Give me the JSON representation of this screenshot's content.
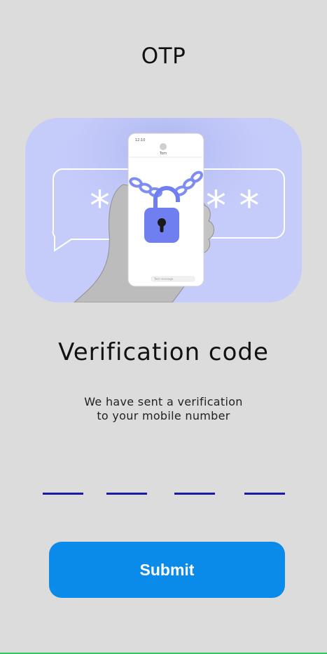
{
  "header": {
    "title": "OTP"
  },
  "illustration": {
    "masked_code_left": "*",
    "masked_code_right": "* *",
    "phone_time": "12:10",
    "contact_label": "Tom",
    "message_placeholder": "Text message"
  },
  "main": {
    "heading": "Verification code",
    "subtext_line1": "We have sent a verification",
    "subtext_line2": "to your mobile number"
  },
  "otp": {
    "digits": [
      "",
      "",
      "",
      ""
    ],
    "underline_color": "#1a1aa6"
  },
  "actions": {
    "submit_label": "Submit"
  },
  "colors": {
    "background": "#dcdcdc",
    "accent": "#0a8bea",
    "illustration_bg": "#c6ccfa",
    "lock": "#6f7ff0"
  }
}
